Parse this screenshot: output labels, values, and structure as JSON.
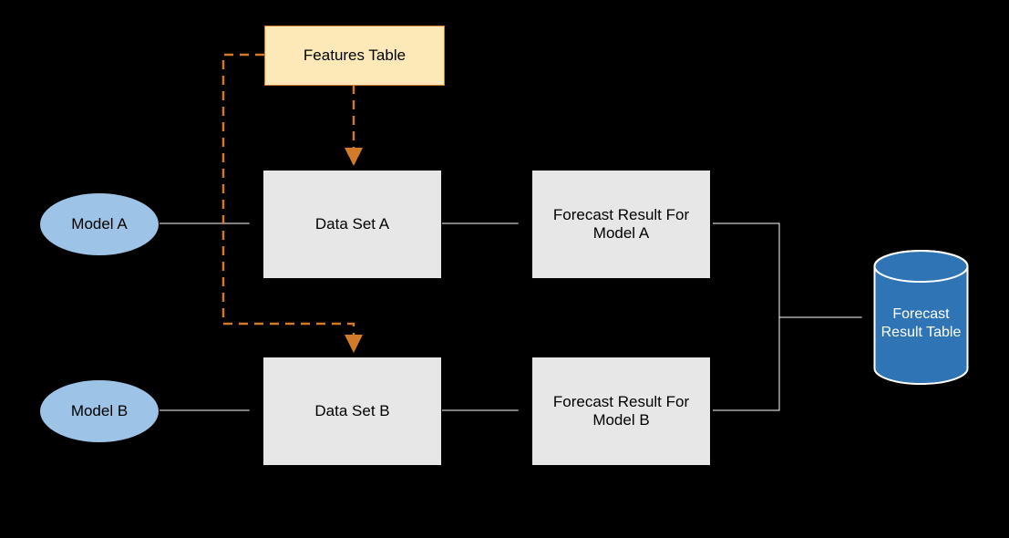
{
  "nodes": {
    "featuresTable": "Features Table",
    "modelA": "Model A",
    "modelB": "Model B",
    "dataSetA": "Data Set A",
    "dataSetB": "Data Set B",
    "forecastA": "Forecast Result For Model A",
    "forecastB": "Forecast Result For Model B",
    "resultTable": "Forecast Result Table"
  },
  "colors": {
    "ellipseFill": "#9dc3e6",
    "rectFill": "#e7e7e7",
    "featuresFill": "#fde9b7",
    "featuresBorder": "#cd7e2c",
    "cylinderFill": "#2f75b5",
    "dashedArrow": "#d17b2a",
    "solidArrow": "#000000"
  }
}
